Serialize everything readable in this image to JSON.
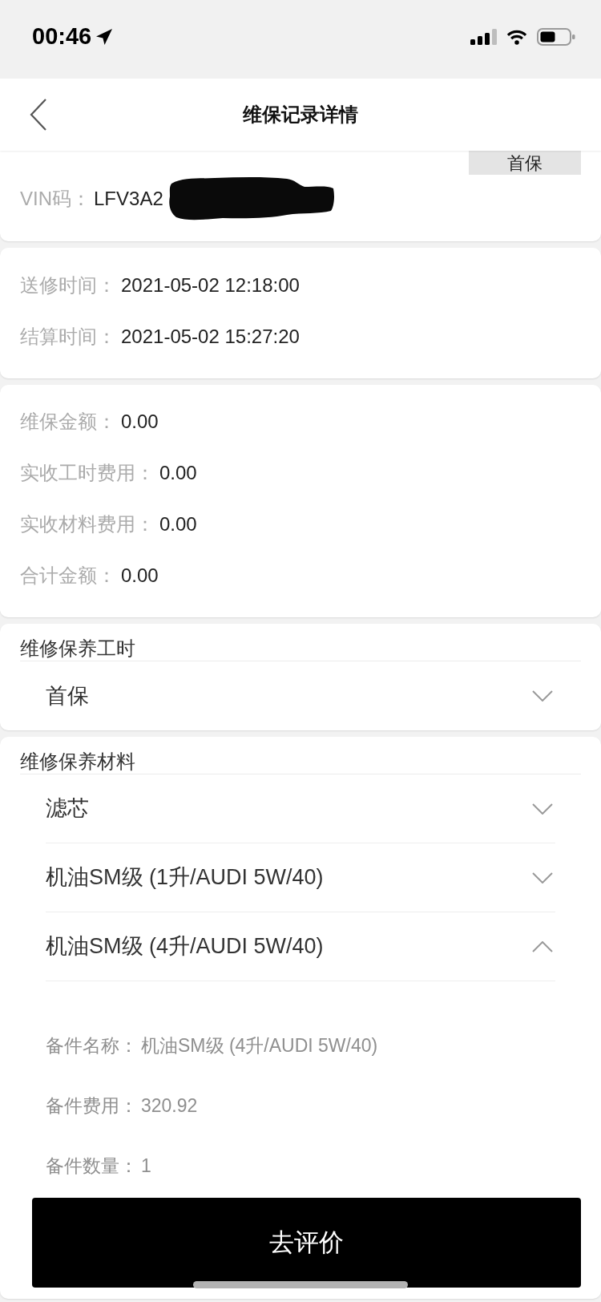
{
  "status_bar": {
    "time": "00:46"
  },
  "nav": {
    "title": "维保记录详情"
  },
  "vehicle": {
    "badge": "首保",
    "vin": {
      "label": "VIN码：",
      "value": "LFV3A2",
      "redacted": true
    }
  },
  "times": [
    {
      "label": "送修时间：",
      "value": "2021-05-02 12:18:00"
    },
    {
      "label": "结算时间：",
      "value": "2021-05-02 15:27:20"
    }
  ],
  "amounts": [
    {
      "label": "维保金额：",
      "value": "0.00"
    },
    {
      "label": "实收工时费用：",
      "value": "0.00"
    },
    {
      "label": "实收材料费用：",
      "value": "0.00"
    },
    {
      "label": "合计金额：",
      "value": "0.00"
    }
  ],
  "labor": {
    "title": "维修保养工时",
    "items": [
      {
        "name": "首保",
        "expanded": false
      }
    ]
  },
  "materials": {
    "title": "维修保养材料",
    "items": [
      {
        "name": "滤芯",
        "expanded": false
      },
      {
        "name": "机油SM级 (1升/AUDI 5W/40)",
        "expanded": false
      },
      {
        "name": "机油SM级 (4升/AUDI 5W/40)",
        "expanded": true,
        "details": [
          {
            "label": "备件名称：",
            "value": "机油SM级 (4升/AUDI 5W/40)"
          },
          {
            "label": "备件费用：",
            "value": "320.92"
          },
          {
            "label": "备件数量：",
            "value": "1"
          }
        ]
      }
    ]
  },
  "action_button": "去评价"
}
